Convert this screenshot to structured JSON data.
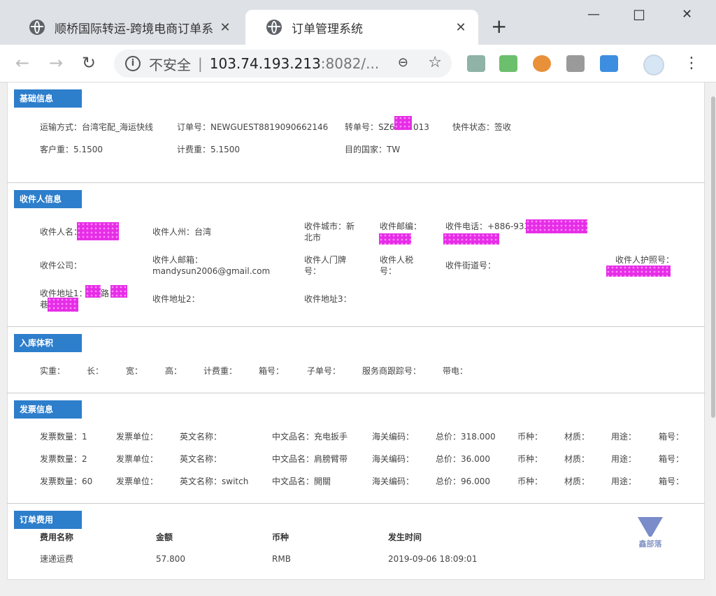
{
  "browser": {
    "tabs": [
      {
        "title": "顺桥国际转运-跨境电商订单系"
      },
      {
        "title": "订单管理系统"
      }
    ],
    "new_tab": "+",
    "address": {
      "security": "不安全",
      "host": "103.74.193.213",
      "rest": ":8082/..."
    },
    "window": {
      "minimize": "—",
      "maximize": "☐",
      "close": "✕"
    }
  },
  "basic": {
    "title": "基础信息",
    "transport": "运输方式：台湾宅配_海运快线",
    "order_no": "订单号：NEWGUEST8819090662146",
    "transfer_no": "转单号：SZ66",
    "transfer_no_tail": "013",
    "status": "快件状态：签收",
    "customer_weight": "客户重：5.1500",
    "charge_weight": "计费重：5.1500",
    "dest_country": "目的国家：TW"
  },
  "recipient": {
    "title": "收件人信息",
    "name": "收件人名：",
    "state": "收件人州：台湾",
    "city": "收件城市：新北市",
    "zip": "收件邮编：",
    "phone": "收件电话：+886-933",
    "company": "收件公司：",
    "email": "收件人邮箱：mandysun2006@gmail.com",
    "door_no": "收件人门牌号：",
    "tax_no": "收件人税号：",
    "street_no": "收件街道号：",
    "passport": "收件人护照号：",
    "addr1": "收件地址1：",
    "addr1_mid": "路",
    "addr1_tail": "巷",
    "addr2": "收件地址2：",
    "addr3": "收件地址3："
  },
  "volume": {
    "title": "入库体积",
    "labels": [
      "实重：",
      "长：",
      "宽：",
      "高：",
      "计费重：",
      "箱号：",
      "子单号：",
      "服务商跟踪号：",
      "带电："
    ]
  },
  "invoice": {
    "title": "发票信息",
    "rows": [
      {
        "qty": "发票数量：1",
        "unit": "发票单位：",
        "en": "英文名称：",
        "cn": "中文品名：充电扳手",
        "hs": "海关编码：",
        "total": "总价：318.000",
        "currency": "币种：",
        "material": "材质：",
        "usage": "用途：",
        "box": "箱号："
      },
      {
        "qty": "发票数量：2",
        "unit": "发票单位：",
        "en": "英文名称：",
        "cn": "中文品名：肩膀臂带",
        "hs": "海关编码：",
        "total": "总价：36.000",
        "currency": "币种：",
        "material": "材质：",
        "usage": "用途：",
        "box": "箱号："
      },
      {
        "qty": "发票数量：60",
        "unit": "发票单位：",
        "en": "英文名称：switch",
        "cn": "中文品名：開關",
        "hs": "海关编码：",
        "total": "总价：96.000",
        "currency": "币种：",
        "material": "材质：",
        "usage": "用途：",
        "box": "箱号："
      }
    ]
  },
  "fees": {
    "title": "订单费用",
    "headers": [
      "费用名称",
      "金额",
      "币种",
      "发生时间"
    ],
    "rows": [
      {
        "name": "速递运费",
        "amount": "57.800",
        "currency": "RMB",
        "time": "2019-09-06 18:09:01"
      }
    ]
  },
  "watermark": {
    "text": "鑫部落"
  },
  "colors": {
    "header_bg": "#2d7ecb",
    "redaction": "#e62de6"
  }
}
